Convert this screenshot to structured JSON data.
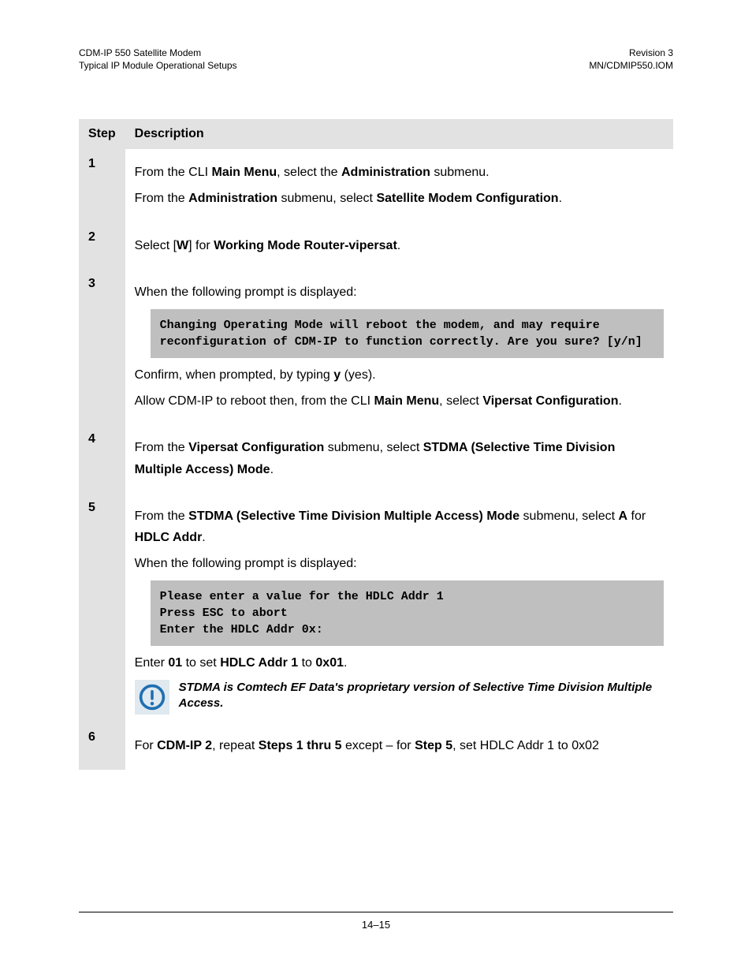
{
  "header": {
    "left_line1": "CDM-IP 550 Satellite Modem",
    "left_line2": "Typical IP Module Operational Setups",
    "right_line1": "Revision 3",
    "right_line2": "MN/CDMIP550.IOM"
  },
  "table": {
    "header_step": "Step",
    "header_desc": "Description"
  },
  "step1": {
    "num": "1",
    "line1": {
      "a": "From the CLI ",
      "b": "Main Menu",
      "c": ", select the ",
      "d": "Administration",
      "e": " submenu."
    },
    "line2": {
      "a": "From the ",
      "b": "Administration",
      "c": " submenu, select ",
      "d": "Satellite Modem Configuration",
      "e": "."
    }
  },
  "step2": {
    "num": "2",
    "line": {
      "a": "Select [",
      "b": "W",
      "c": "] for ",
      "d": "Working Mode Router-vipersat",
      "e": "."
    }
  },
  "step3": {
    "num": "3",
    "line1": "When the following prompt is displayed:",
    "code": "Changing Operating Mode will reboot the modem, and may require reconfiguration of CDM-IP to function correctly. Are you sure? [y/n]",
    "line2": {
      "a": "Confirm, when prompted, by typing ",
      "b": "y",
      "c": " (yes)."
    },
    "line3": {
      "a": "Allow CDM-IP to reboot then, from the CLI ",
      "b": "Main Menu",
      "c": ", select ",
      "d": "Vipersat Configuration",
      "e": "."
    }
  },
  "step4": {
    "num": "4",
    "line": {
      "a": "From the ",
      "b": "Vipersat Configuration",
      "c": " submenu, select ",
      "d": "STDMA (Selective Time Division Multiple Access) Mode",
      "e": "."
    }
  },
  "step5": {
    "num": "5",
    "line1": {
      "a": "From the ",
      "b": "STDMA (Selective Time Division Multiple Access) Mode",
      "c": " submenu, select ",
      "d": "A",
      "e": " for ",
      "f": "HDLC Addr",
      "g": "."
    },
    "line2": "When the following prompt is displayed:",
    "code": "Please enter a value for the HDLC Addr 1\nPress ESC to abort\nEnter the HDLC Addr 0x:",
    "line3": {
      "a": "Enter ",
      "b": "01",
      "c": " to set ",
      "d": "HDLC Addr 1",
      "e": " to ",
      "f": "0x01",
      "g": "."
    },
    "note": "STDMA is Comtech EF Data's proprietary version of Selective Time Division Multiple Access."
  },
  "step6": {
    "num": "6",
    "line": {
      "a": "For ",
      "b": "CDM-IP 2",
      "c": ", repeat ",
      "d": "Steps 1 thru 5",
      "e": " except – for ",
      "f": "Step 5",
      "g": ", set HDLC Addr 1 to 0x02"
    }
  },
  "footer": "14–15"
}
